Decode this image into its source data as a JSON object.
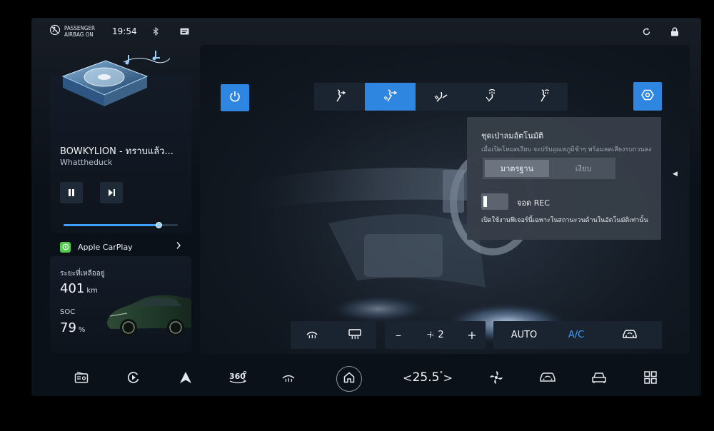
{
  "status_bar": {
    "airbag_line1": "PASSENGER",
    "airbag_line2": "AIRBAG  ON",
    "time": "19:54",
    "icons": [
      "airbag-off-icon",
      "bluetooth-icon",
      "message-icon",
      "refresh-icon",
      "lock-icon"
    ]
  },
  "media": {
    "title": "BOWKYLION - ทราบแล้ว...",
    "artist": "Whattheduck",
    "progress_fraction": 0.84,
    "source_label": "Apple CarPlay",
    "controls": [
      "pause-icon",
      "next-track-icon"
    ]
  },
  "range": {
    "range_label": "ระยะที่เหลืออยู่",
    "range_value": "401",
    "range_unit": "km",
    "soc_label": "SOC",
    "soc_value": "79",
    "soc_unit": "%"
  },
  "climate": {
    "airflow_modes": [
      "face-vent-icon",
      "face-feet-vent-icon",
      "feet-vent-icon",
      "feet-defrost-vent-icon",
      "defrost-face-vent-icon"
    ],
    "active_mode_index": 1,
    "defrost_icons": [
      "front-defrost-icon",
      "rear-defrost-icon"
    ],
    "fan_minus": "–",
    "fan_speed": "2",
    "fan_plus": "+",
    "auto_label": "AUTO",
    "ac_label": "A/C",
    "accent_color": "#2f86e0"
  },
  "popup": {
    "title": "ชุดเป่าลมอัตโนมัติ",
    "description": "เมื่อเปิดโหมดเงียบ จะปรับอุณหภูมิช้าๆ พร้อมลดเสียงรบกวนลง",
    "segments": [
      "มาตรฐาน",
      "เงียบ"
    ],
    "active_segment": 0,
    "rec_label": "จอด REC",
    "rec_description": "เปิดใช้งานฟีเจอร์นี้เฉพาะในสถานะวนด้านในอัตโนมัติเท่านั้น",
    "side_arrow": "◀"
  },
  "dock": {
    "temperature": "25.5",
    "degree": "°",
    "temp_left": "<",
    "temp_right": ">",
    "items": [
      "radio-icon",
      "play-icon",
      "navigation-icon",
      "camera-360-icon",
      "rear-defrost-icon",
      "home-icon",
      "fan-icon",
      "car-climate-icon",
      "seat-icon",
      "apps-grid-icon"
    ]
  }
}
